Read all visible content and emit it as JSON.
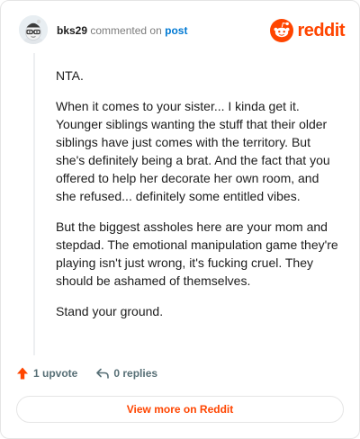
{
  "comment": {
    "username": "bks29",
    "verb": "commented on",
    "post_link": "post",
    "paragraphs": [
      "NTA.",
      "When it comes to your sister... I kinda get it. Younger siblings wanting the stuff that their older siblings have just comes with the territory. But she's definitely being a brat. And the fact that you offered to help her decorate her own room, and she refused... definitely some entitled vibes.",
      "But the biggest assholes here are your mom and stepdad. The emotional manipulation game they're playing isn't just wrong, it's fucking cruel. They should be ashamed of themselves.",
      "Stand your ground."
    ]
  },
  "brand": {
    "wordmark": "reddit",
    "color": "#ff4500",
    "icon": "reddit-logo-icon"
  },
  "actions": {
    "upvotes": "1 upvote",
    "upvote_icon": "upvote-arrow-icon",
    "replies": "0 replies",
    "reply_icon": "reply-arrow-icon"
  },
  "cta": {
    "label": "View more on Reddit"
  },
  "colors": {
    "accent": "#ff4500",
    "link": "#0079d3",
    "muted": "#576f76"
  }
}
